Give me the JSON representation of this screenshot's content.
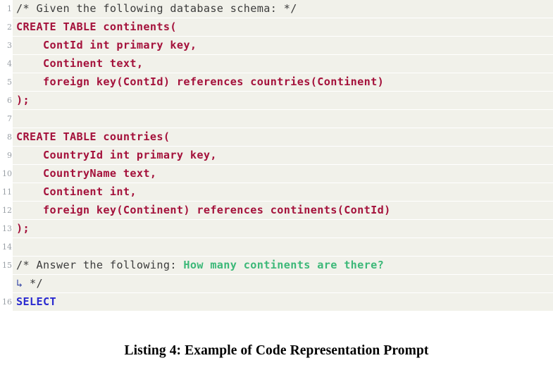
{
  "listing": {
    "language": "sql",
    "colors": {
      "code_background": "#f1f1ea",
      "page_background": "#ffffff",
      "gutter_text": "#9aa0a6",
      "comment": "#3c3c3c",
      "keyword_red": "#a4113b",
      "keyword_blue": "#2a2ad0",
      "question_green": "#3cb878",
      "wrap_marker": "#3b4ba8"
    },
    "wrap_marker_glyph": "↳",
    "lines": [
      {
        "number": "1",
        "tokens": [
          {
            "text": "/* Given the following database schema: */",
            "style": "comment"
          }
        ]
      },
      {
        "number": "2",
        "tokens": [
          {
            "text": "CREATE TABLE continents(",
            "style": "keyword"
          }
        ]
      },
      {
        "number": "3",
        "tokens": [
          {
            "text": "    ContId int primary key,",
            "style": "keyword"
          }
        ]
      },
      {
        "number": "4",
        "tokens": [
          {
            "text": "    Continent text,",
            "style": "keyword"
          }
        ]
      },
      {
        "number": "5",
        "tokens": [
          {
            "text": "    foreign key(ContId) references countries(Continent)",
            "style": "keyword"
          }
        ]
      },
      {
        "number": "6",
        "tokens": [
          {
            "text": ");",
            "style": "keyword"
          }
        ]
      },
      {
        "number": "7",
        "tokens": [
          {
            "text": "",
            "style": "plain"
          }
        ]
      },
      {
        "number": "8",
        "tokens": [
          {
            "text": "CREATE TABLE countries(",
            "style": "keyword"
          }
        ]
      },
      {
        "number": "9",
        "tokens": [
          {
            "text": "    CountryId int primary key,",
            "style": "keyword"
          }
        ]
      },
      {
        "number": "10",
        "tokens": [
          {
            "text": "    CountryName text,",
            "style": "keyword"
          }
        ]
      },
      {
        "number": "11",
        "tokens": [
          {
            "text": "    Continent int,",
            "style": "keyword"
          }
        ]
      },
      {
        "number": "12",
        "tokens": [
          {
            "text": "    foreign key(Continent) references continents(ContId)",
            "style": "keyword"
          }
        ]
      },
      {
        "number": "13",
        "tokens": [
          {
            "text": ");",
            "style": "keyword"
          }
        ]
      },
      {
        "number": "14",
        "tokens": [
          {
            "text": "",
            "style": "plain"
          }
        ]
      },
      {
        "number": "15",
        "tokens": [
          {
            "text": "/* Answer the following: ",
            "style": "comment"
          },
          {
            "text": "How many continents are there?",
            "style": "green"
          }
        ]
      },
      {
        "number": "",
        "wrapped": true,
        "tokens": [
          {
            "text": "↳ ",
            "style": "wrap"
          },
          {
            "text": "*/",
            "style": "comment"
          }
        ]
      },
      {
        "number": "16",
        "tokens": [
          {
            "text": "SELECT",
            "style": "keyword_blue"
          }
        ]
      }
    ]
  },
  "caption": {
    "text": "Listing 4: Example of Code Representation Prompt"
  }
}
